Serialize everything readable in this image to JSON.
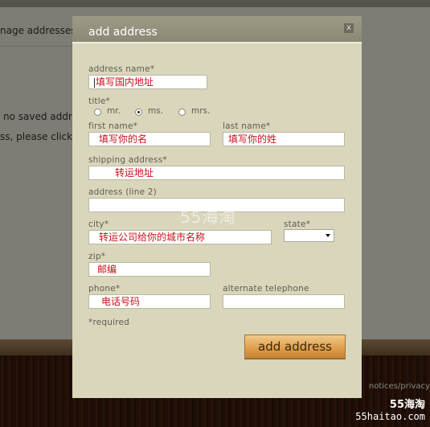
{
  "background": {
    "manage_text": "nage addresses",
    "no_saved_text": "no saved addre",
    "please_click_text": "ss, please click",
    "footer_link": "notices/privacy"
  },
  "modal": {
    "title": "add address",
    "close_symbol": "x",
    "fields": {
      "address_name": {
        "label": "address name*",
        "value": "填写国内地址"
      },
      "title": {
        "label": "title*",
        "options": [
          "mr.",
          "ms.",
          "mrs."
        ],
        "selected": "ms."
      },
      "first_name": {
        "label": "first name*",
        "value": "填写你的名"
      },
      "last_name": {
        "label": "last name*",
        "value": "填写你的姓"
      },
      "shipping_address": {
        "label": "shipping address*",
        "value": "转运地址"
      },
      "address_line2": {
        "label": "address (line 2)",
        "value": ""
      },
      "city": {
        "label": "city*",
        "value": "转运公司给你的城市名称"
      },
      "state": {
        "label": "state*",
        "value": ""
      },
      "zip": {
        "label": "zip*",
        "value": "邮编"
      },
      "phone": {
        "label": "phone*",
        "value": "电话号码"
      },
      "alternate_telephone": {
        "label": "alternate telephone",
        "value": ""
      }
    },
    "required_note": "*required",
    "submit_label": "add address"
  },
  "watermark": {
    "center": "55海淘",
    "corner_line1": "55海淘",
    "corner_line2": "55haitao.com"
  },
  "colors": {
    "modal_bg": "#d9d6bc",
    "header_bg": "#9d9a86",
    "input_text": "#c8101b",
    "button_orange": "#e0a04d"
  }
}
